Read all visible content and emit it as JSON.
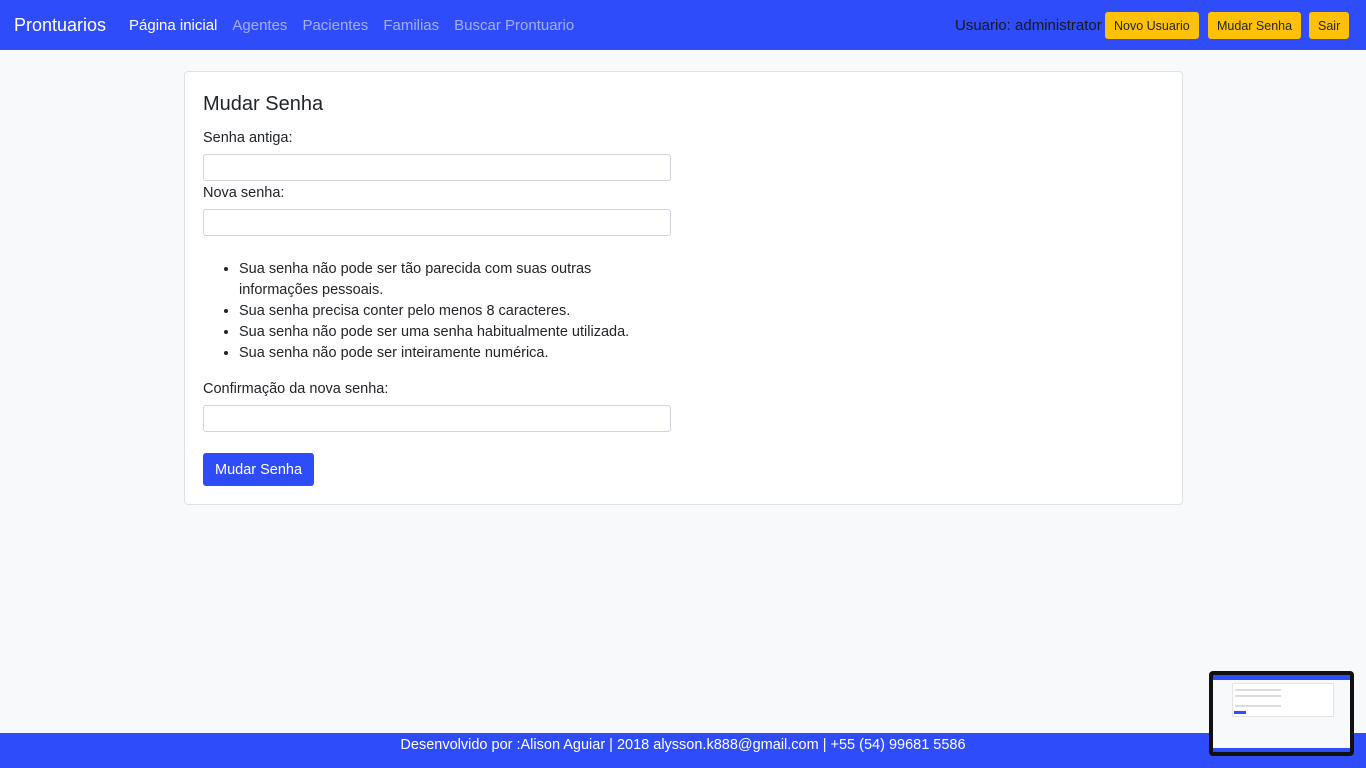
{
  "navbar": {
    "brand": "Prontuarios",
    "links": [
      {
        "label": "Página inicial",
        "active": true
      },
      {
        "label": "Agentes",
        "active": false
      },
      {
        "label": "Pacientes",
        "active": false
      },
      {
        "label": "Familias",
        "active": false
      },
      {
        "label": "Buscar Prontuario",
        "active": false
      }
    ],
    "user_text": "Usuario: administrator",
    "buttons": {
      "new_user": "Novo Usuario",
      "change_password": "Mudar Senha",
      "logout": "Sair"
    }
  },
  "form": {
    "title": "Mudar Senha",
    "old_password_label": "Senha antiga:",
    "old_password_value": "",
    "new_password_label": "Nova senha:",
    "new_password_value": "",
    "rules": [
      "Sua senha não pode ser tão parecida com suas outras informações pessoais.",
      "Sua senha precisa conter pelo menos 8 caracteres.",
      "Sua senha não pode ser uma senha habitualmente utilizada.",
      "Sua senha não pode ser inteiramente numérica."
    ],
    "confirm_label": "Confirmação da nova senha:",
    "confirm_value": "",
    "submit_label": "Mudar Senha"
  },
  "footer": {
    "text": "Desenvolvido por :Alison Aguiar | 2018 alysson.k888@gmail.com | +55 (54) 99681 5586"
  },
  "colors": {
    "primary": "#2e4cf9",
    "warning": "#ffc107",
    "background": "#f8f9fa"
  }
}
